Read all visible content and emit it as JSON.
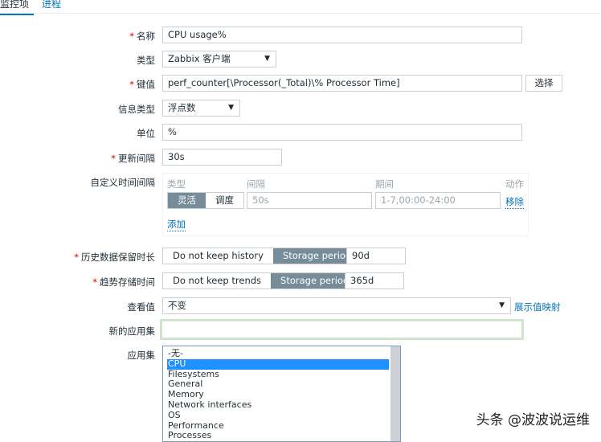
{
  "tabs": [
    "监控项",
    "进程"
  ],
  "form": {
    "name": {
      "label": "名称",
      "value": "CPU usage%"
    },
    "type": {
      "label": "类型",
      "value": "Zabbix 客户端"
    },
    "key": {
      "label": "键值",
      "value": "perf_counter[\\Processor(_Total)\\% Processor Time]",
      "button": "选择"
    },
    "info_type": {
      "label": "信息类型",
      "value": "浮点数"
    },
    "unit": {
      "label": "单位",
      "value": "%"
    },
    "update": {
      "label": "更新间隔",
      "value": "30s"
    },
    "custom": {
      "label": "自定义时间间隔",
      "headers": [
        "类型",
        "间隔",
        "期间",
        "动作"
      ],
      "modes": [
        "灵活",
        "调度"
      ],
      "interval": "50s",
      "period": "1-7,00:00-24:00",
      "remove": "移除",
      "add": "添加"
    },
    "history": {
      "label": "历史数据保留时长",
      "options": [
        "Do not keep history",
        "Storage period"
      ],
      "value": "90d"
    },
    "trends": {
      "label": "趋势存储时间",
      "options": [
        "Do not keep trends",
        "Storage period"
      ],
      "value": "365d"
    },
    "show_value": {
      "label": "查看值",
      "value": "不变",
      "link": "展示值映射"
    },
    "new_app": {
      "label": "新的应用集",
      "value": ""
    },
    "apps": {
      "label": "应用集",
      "items": [
        "-无-",
        "CPU",
        "Filesystems",
        "General",
        "Memory",
        "Network interfaces",
        "OS",
        "Performance",
        "Processes"
      ],
      "selected": "CPU"
    }
  },
  "watermark": "头条 @波波说运维"
}
